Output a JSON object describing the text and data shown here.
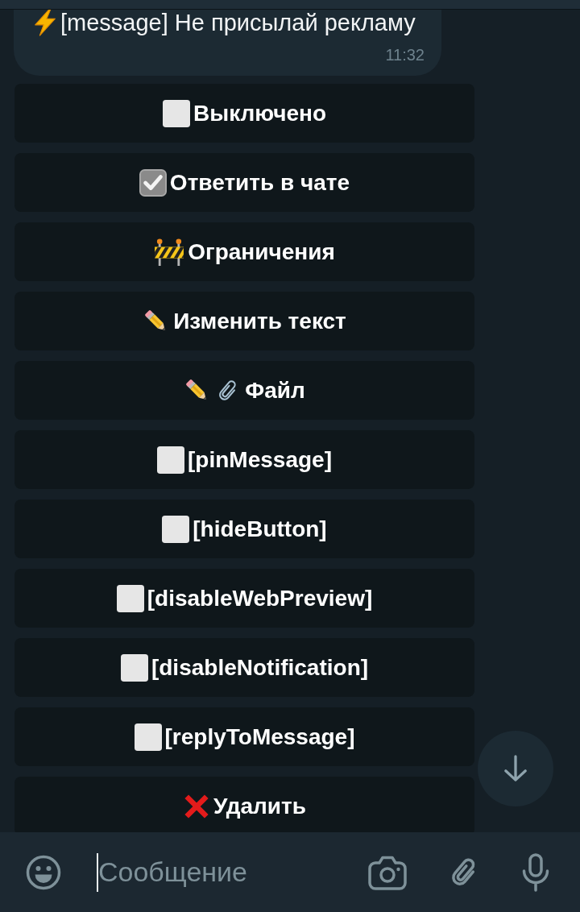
{
  "message": {
    "text": "[message] Не присылай рекламу",
    "time": "11:32"
  },
  "buttons": [
    {
      "label": "Выключено",
      "kind": "toggle",
      "checked": false
    },
    {
      "label": "Ответить в чате",
      "kind": "toggle",
      "checked": true
    },
    {
      "label": "Ограничения",
      "kind": "limits"
    },
    {
      "label": "Изменить текст",
      "kind": "edit"
    },
    {
      "label": "Файл",
      "kind": "file"
    },
    {
      "label": "[pinMessage]",
      "kind": "toggle",
      "checked": false
    },
    {
      "label": "[hideButton]",
      "kind": "toggle",
      "checked": false
    },
    {
      "label": "[disableWebPreview]",
      "kind": "toggle",
      "checked": false
    },
    {
      "label": "[disableNotification]",
      "kind": "toggle",
      "checked": false
    },
    {
      "label": "[replyToMessage]",
      "kind": "toggle",
      "checked": false
    },
    {
      "label": "Удалить",
      "kind": "delete"
    }
  ],
  "composer": {
    "placeholder": "Сообщение"
  }
}
